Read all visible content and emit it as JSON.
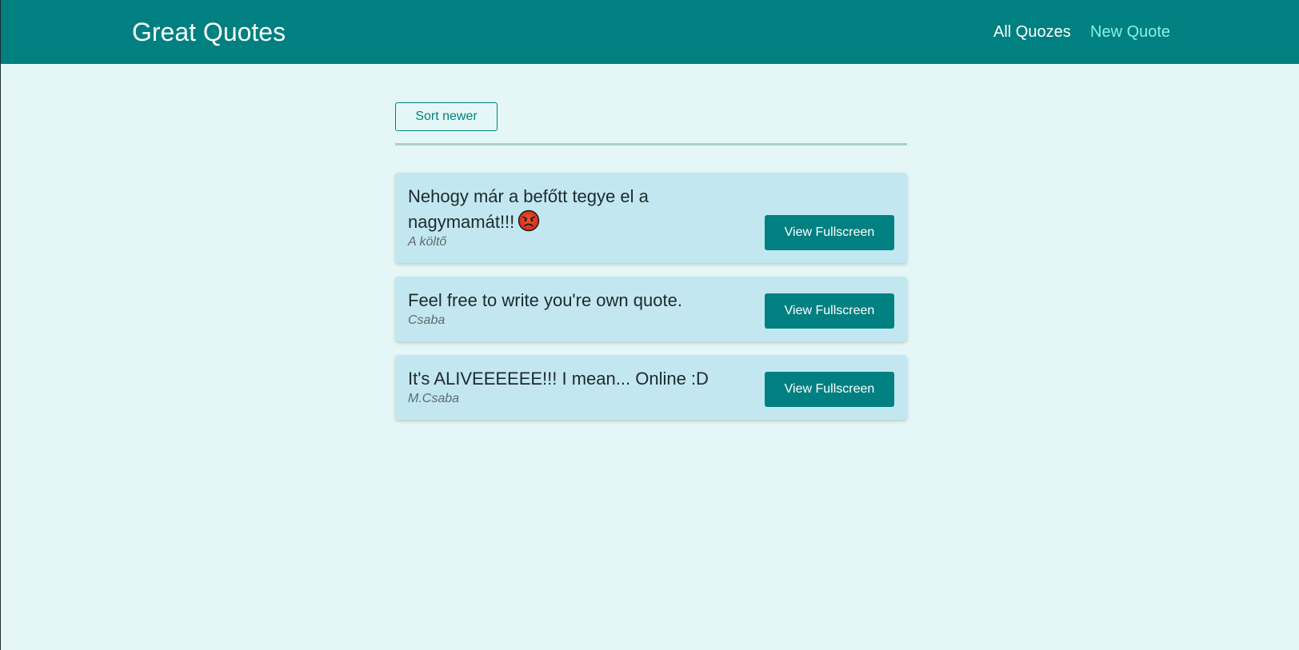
{
  "header": {
    "logo": "Great Quotes",
    "nav": [
      {
        "label": "All Quozes",
        "active": false
      },
      {
        "label": "New Quote",
        "active": true
      }
    ],
    "background_color": "#008080",
    "active_link_color": "#88f1e8"
  },
  "toolbar": {
    "sort_label": "Sort newer"
  },
  "quotes": [
    {
      "text": "Nehogy már a befőtt tegye el a nagymamát!!!",
      "emoji_icon": "angry-face-icon",
      "author": "A költő",
      "button_label": "View Fullscreen"
    },
    {
      "text": "Feel free to write you're own quote.",
      "author": "Csaba",
      "button_label": "View Fullscreen"
    },
    {
      "text": "It's ALIVEEEEEE!!! I mean... Online :D",
      "author": "M.Csaba",
      "button_label": "View Fullscreen"
    }
  ],
  "colors": {
    "page_background": "#e4f7f6",
    "card_background": "#c2e7f0",
    "accent": "#008080"
  }
}
